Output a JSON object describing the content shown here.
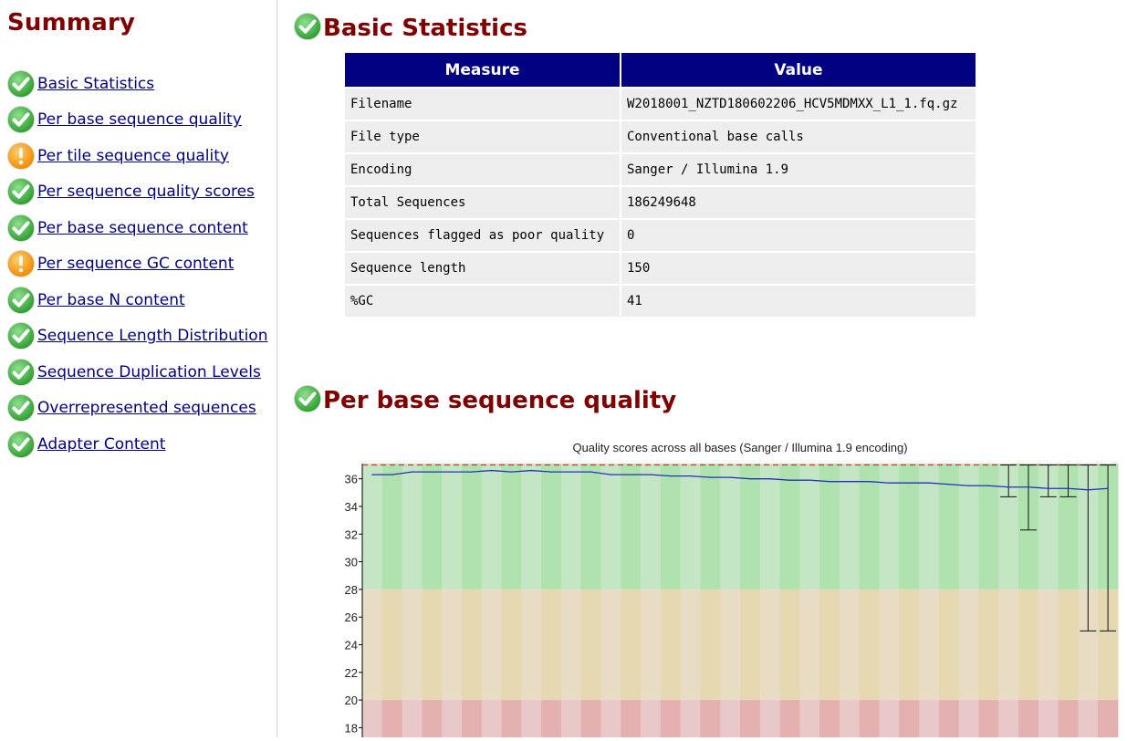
{
  "sidebar": {
    "title": "Summary",
    "items": [
      {
        "label": "Basic Statistics",
        "status": "pass"
      },
      {
        "label": "Per base sequence quality",
        "status": "pass"
      },
      {
        "label": "Per tile sequence quality",
        "status": "warn"
      },
      {
        "label": "Per sequence quality scores",
        "status": "pass"
      },
      {
        "label": "Per base sequence content",
        "status": "pass"
      },
      {
        "label": "Per sequence GC content",
        "status": "warn"
      },
      {
        "label": "Per base N content",
        "status": "pass"
      },
      {
        "label": "Sequence Length Distribution",
        "status": "pass"
      },
      {
        "label": "Sequence Duplication Levels",
        "status": "pass"
      },
      {
        "label": "Overrepresented sequences",
        "status": "pass"
      },
      {
        "label": "Adapter Content",
        "status": "pass"
      }
    ]
  },
  "colors": {
    "heading": "#800000",
    "table_header": "#000080",
    "link": "#000080",
    "pass_icon": "#2e9e2e",
    "warn_icon": "#f08a00"
  },
  "basic_stats": {
    "title": "Basic Statistics",
    "status": "pass",
    "headers": [
      "Measure",
      "Value"
    ],
    "rows": [
      [
        "Filename",
        "W2018001_NZTD180602206_HCV5MDMXX_L1_1.fq.gz"
      ],
      [
        "File type",
        "Conventional base calls"
      ],
      [
        "Encoding",
        "Sanger / Illumina 1.9"
      ],
      [
        "Total Sequences",
        "186249648"
      ],
      [
        "Sequences flagged as poor quality",
        "0"
      ],
      [
        "Sequence length",
        "150"
      ],
      [
        "%GC",
        "41"
      ]
    ]
  },
  "per_base_quality": {
    "title": "Per base sequence quality",
    "status": "pass"
  },
  "chart_data": {
    "type": "line",
    "title": "Quality scores across all bases (Sanger / Illumina 1.9 encoding)",
    "y_ticks": [
      36,
      34,
      32,
      30,
      28,
      26,
      24,
      22,
      20,
      18
    ],
    "ylim_visible": [
      17.3,
      37.1
    ],
    "zones": [
      {
        "name": "good",
        "from": 28,
        "to": 37.1,
        "colors": [
          "#c4e6c4",
          "#b0e2b0"
        ]
      },
      {
        "name": "reasonable",
        "from": 20,
        "to": 28,
        "colors": [
          "#e8dcc4",
          "#e6d8b0"
        ]
      },
      {
        "name": "poor",
        "from": 17.3,
        "to": 20,
        "colors": [
          "#e8c8c8",
          "#e4b0b0"
        ]
      }
    ],
    "num_bins": 38,
    "threshold_line": 37,
    "mean_series": {
      "name": "mean",
      "color": "#2233bb",
      "values": [
        36.3,
        36.3,
        36.5,
        36.5,
        36.5,
        36.5,
        36.6,
        36.5,
        36.6,
        36.5,
        36.5,
        36.5,
        36.3,
        36.3,
        36.3,
        36.2,
        36.2,
        36.1,
        36.1,
        36.0,
        36.0,
        35.9,
        35.9,
        35.8,
        35.8,
        35.8,
        35.7,
        35.7,
        35.7,
        35.6,
        35.5,
        35.5,
        35.4,
        35.4,
        35.3,
        35.3,
        35.2,
        35.3
      ]
    },
    "whiskers": [
      {
        "bin": 32,
        "top": 37,
        "bottom": 34.7
      },
      {
        "bin": 33,
        "top": 37,
        "bottom": 32.3
      },
      {
        "bin": 34,
        "top": 37,
        "bottom": 34.7
      },
      {
        "bin": 35,
        "top": 37,
        "bottom": 34.7
      },
      {
        "bin": 36,
        "top": 37,
        "bottom": 25
      },
      {
        "bin": 37,
        "top": 37,
        "bottom": 25
      }
    ]
  }
}
